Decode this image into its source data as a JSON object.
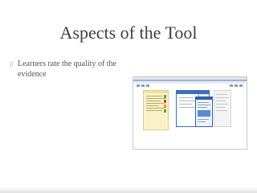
{
  "slide": {
    "title": "Aspects of the Tool",
    "bullets": [
      {
        "marker": "0",
        "text": "Learners rate the quality of the evidence"
      }
    ]
  },
  "screenshot": {
    "description_icon": "app-screenshot-image"
  },
  "colors": {
    "background": "#ffffff",
    "title": "#404040",
    "body_text": "#555555",
    "accent_blue": "#3c6fb5",
    "note_yellow": "#f9f2c9",
    "indicator_green": "#4caf50",
    "indicator_red": "#e53935",
    "indicator_orange": "#ff9800"
  }
}
